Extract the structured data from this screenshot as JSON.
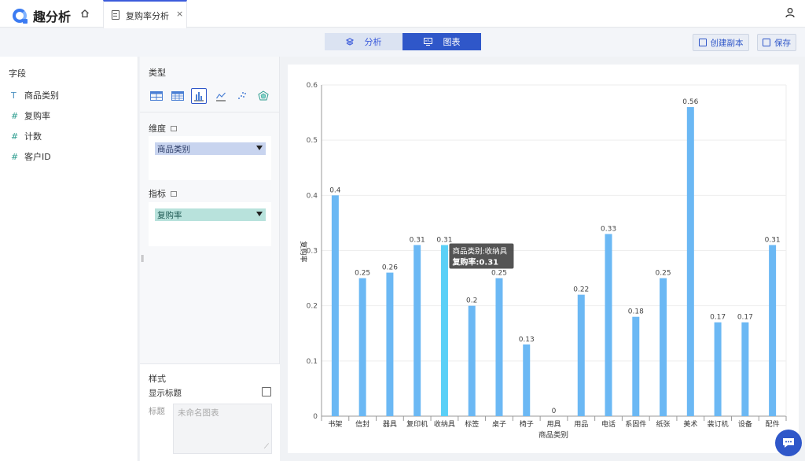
{
  "app": {
    "name": "趣分析"
  },
  "tab": {
    "label": "复购率分析",
    "close": "×"
  },
  "toolbar": {
    "analysis_label": "分析",
    "chart_label": "图表",
    "copy_label": "创建副本",
    "save_label": "保存"
  },
  "fields": {
    "title": "字段",
    "items": [
      {
        "type_symbol": "T",
        "label": "商品类别"
      },
      {
        "type_symbol": "#",
        "label": "复购率"
      },
      {
        "type_symbol": "#",
        "label": "计数"
      },
      {
        "type_symbol": "#",
        "label": "客户ID"
      }
    ]
  },
  "config": {
    "type_title": "类型",
    "dimension_title": "维度",
    "dimension_value": "商品类别",
    "metric_title": "指标",
    "metric_value": "复购率",
    "style_title": "样式",
    "show_title_label": "显示标题",
    "show_title_checked": false,
    "title_label": "标题",
    "title_placeholder": "未命名图表"
  },
  "chart_data": {
    "type": "bar",
    "xlabel": "商品类别",
    "ylabel": "复购率",
    "ylim": [
      0,
      0.6
    ],
    "yticks": [
      "0",
      "0.1",
      "0.2",
      "0.3",
      "0.4",
      "0.5",
      "0.6"
    ],
    "categories": [
      "书架",
      "信封",
      "器具",
      "复印机",
      "收纳具",
      "标签",
      "桌子",
      "椅子",
      "用具",
      "用品",
      "电话",
      "系固件",
      "纸张",
      "美术",
      "装订机",
      "设备",
      "配件"
    ],
    "values": [
      0.4,
      0.25,
      0.26,
      0.31,
      0.31,
      0.2,
      0.25,
      0.13,
      0,
      0.22,
      0.33,
      0.18,
      0.25,
      0.56,
      0.17,
      0.17,
      0.31
    ],
    "labels": [
      "0.4",
      "0.25",
      "0.26",
      "0.31",
      "0.31",
      "0.2",
      "0.25",
      "0.13",
      "0",
      "0.22",
      "0.33",
      "0.18",
      "0.25",
      "0.56",
      "0.17",
      "0.17",
      "0.31"
    ],
    "bar_color": "#6bb8f4",
    "highlight_color": "#5ad0f7",
    "highlight_index": 4,
    "tooltip": {
      "line1": "商品类别:收纳具",
      "line2": "复购率:0.31"
    }
  }
}
